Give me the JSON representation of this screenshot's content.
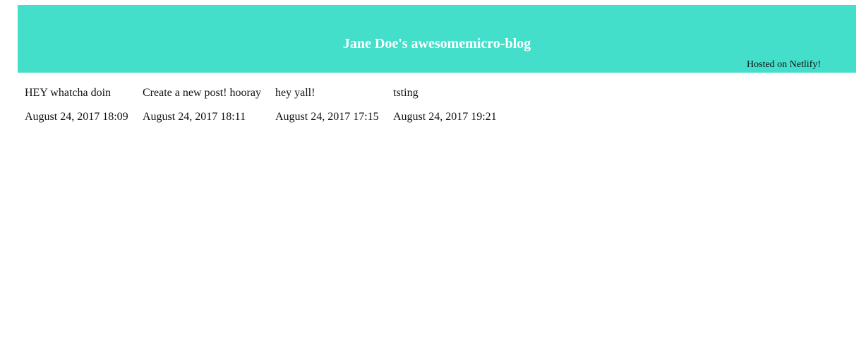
{
  "header": {
    "title": "Jane Doe's awesomemicro-blog",
    "hosted_text": "Hosted on Netlify!",
    "background_color": "#43dfca"
  },
  "posts": [
    {
      "title": "HEY whatcha doin",
      "date": "August 24, 2017 18:09"
    },
    {
      "title": "Create a new post! hooray",
      "date": "August 24, 2017 18:11"
    },
    {
      "title": "hey yall!",
      "date": "August 24, 2017 17:15"
    },
    {
      "title": "tsting",
      "date": "August 24, 2017 19:21"
    }
  ]
}
